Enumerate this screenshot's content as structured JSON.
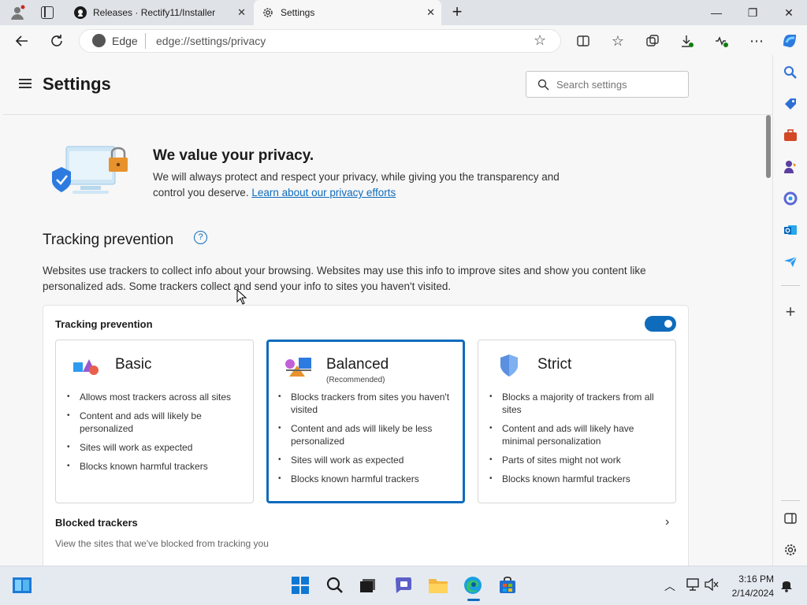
{
  "browser": {
    "tabs": [
      {
        "title": "Releases · Rectify11/Installer"
      },
      {
        "title": "Settings"
      }
    ],
    "address": {
      "site_label": "Edge",
      "url": "edge://settings/privacy"
    }
  },
  "settings": {
    "title": "Settings",
    "search_placeholder": "Search settings"
  },
  "privacy": {
    "heading": "We value your privacy.",
    "text": "We will always protect and respect your privacy, while giving you the transparency and control you deserve.",
    "link": "Learn about our privacy efforts"
  },
  "tracking": {
    "heading": "Tracking prevention",
    "description": "Websites use trackers to collect info about your browsing. Websites may use this info to improve sites and show you content like personalized ads. Some trackers collect and send your info to sites you haven't visited.",
    "toggle_label": "Tracking prevention",
    "toggle_on": true,
    "options": [
      {
        "name": "Basic",
        "sub": "",
        "bullets": [
          "Allows most trackers across all sites",
          "Content and ads will likely be personalized",
          "Sites will work as expected",
          "Blocks known harmful trackers"
        ]
      },
      {
        "name": "Balanced",
        "sub": "(Recommended)",
        "bullets": [
          "Blocks trackers from sites you haven't visited",
          "Content and ads will likely be less personalized",
          "Sites will work as expected",
          "Blocks known harmful trackers"
        ]
      },
      {
        "name": "Strict",
        "sub": "",
        "bullets": [
          "Blocks a majority of trackers from all sites",
          "Content and ads will likely have minimal personalization",
          "Parts of sites might not work",
          "Blocks known harmful trackers"
        ]
      }
    ],
    "selected": "Balanced",
    "blocked_title": "Blocked trackers",
    "blocked_sub": "View the sites that we've blocked from tracking you"
  },
  "taskbar": {
    "time": "3:16 PM",
    "date": "2/14/2024"
  },
  "colors": {
    "accent": "#0f6cbd",
    "link": "#0f6cbd"
  }
}
